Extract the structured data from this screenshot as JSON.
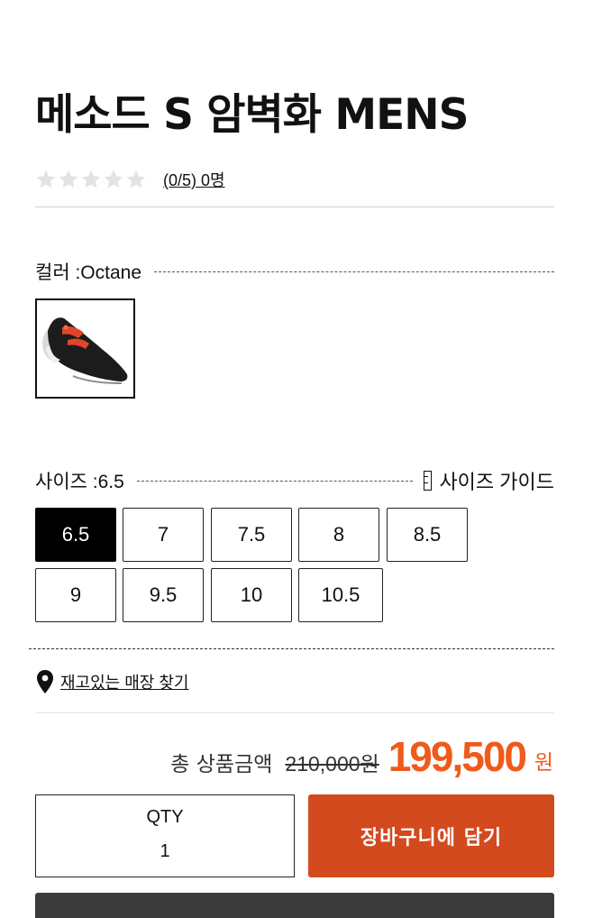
{
  "product": {
    "title": "메소드 S 암벽화 MENS"
  },
  "rating": {
    "score": 0,
    "max": 5,
    "link_text": "(0/5) 0명"
  },
  "color_option": {
    "label": "컬러 :Octane",
    "swatch_icon": "shoe-thumbnail"
  },
  "size_option": {
    "label": "사이즈 :6.5",
    "guide_icon": "ruler-icon",
    "guide_text": "사이즈 가이드",
    "sizes": [
      "6.5",
      "7",
      "7.5",
      "8",
      "8.5",
      "9",
      "9.5",
      "10",
      "10.5"
    ],
    "selected": "6.5"
  },
  "store": {
    "icon": "location-pin-icon",
    "link_text": "재고있는 매장 찾기"
  },
  "price": {
    "label": "총 상품금액",
    "original": "210,000원",
    "sale": "199,500",
    "unit": "원",
    "accent_color": "#f05a1a"
  },
  "qty": {
    "label": "QTY",
    "value": "1"
  },
  "cart_button": {
    "label": "장바구니에 담기",
    "color": "#d24a1e"
  }
}
